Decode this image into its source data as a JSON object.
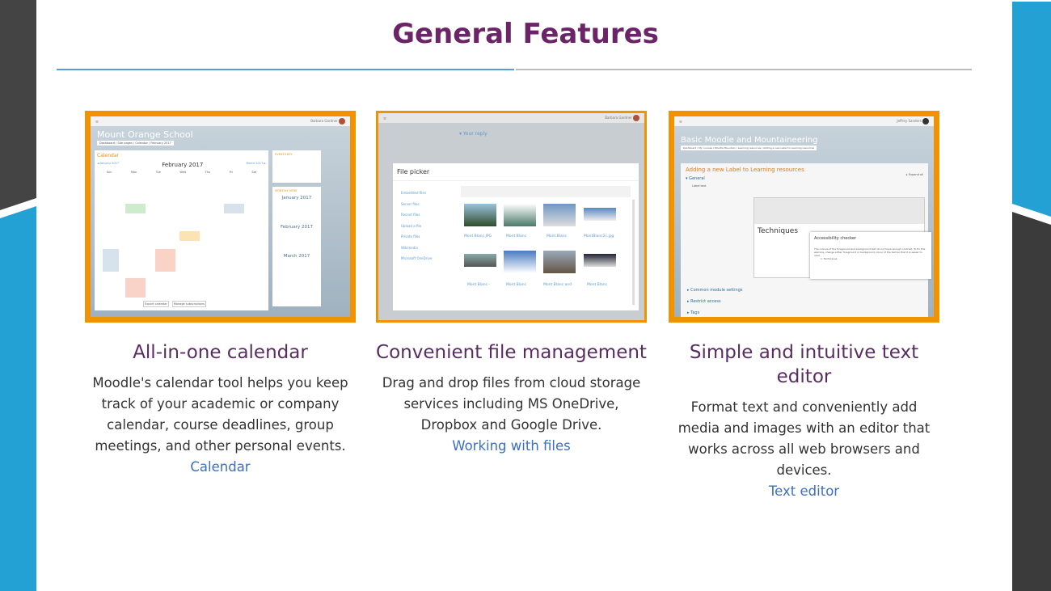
{
  "slide": {
    "title": "General Features",
    "colors": {
      "title": "#6b2468",
      "accent_blue": "#23a0d4",
      "dark": "#3f3f3f",
      "frame": "#f39200",
      "link": "#3d6fc0"
    }
  },
  "cards": [
    {
      "title": "All-in-one calendar",
      "description": "Moodle's calendar tool helps you keep track of your academic or company calendar, course deadlines, group meetings, and other personal events.",
      "link": "Calendar",
      "screenshot": {
        "site": "Mount Orange School",
        "breadcrumb": "Dashboard / Site pages / Calendar / February 2017",
        "heading": "Calendar",
        "month": "February 2017",
        "prev": "◄ January 2017",
        "next": "March 2017 ►",
        "new_event": "New event",
        "days": [
          "Sun",
          "Mon",
          "Tue",
          "Wed",
          "Thu",
          "Fri",
          "Sat"
        ],
        "block_key": "EVENTS KEY",
        "block_month": "MONTHLY VIEW",
        "mini": [
          "January 2017",
          "February 2017",
          "March 2017"
        ],
        "buttons": [
          "Export calendar",
          "Manage subscriptions"
        ],
        "user": "Barbara Gardner"
      }
    },
    {
      "title": "Convenient file management",
      "description": "Drag and drop files from cloud storage services including MS OneDrive, Dropbox and Google Drive.",
      "link": "Working with files",
      "screenshot": {
        "dialog_title": "File picker",
        "reply": "▾ Your reply",
        "sources": [
          "Embedded files",
          "Server files",
          "Recent files",
          "Upload a file",
          "Private files",
          "Wikimedia",
          "Microsoft OneDrive"
        ],
        "files": [
          "Mont Blanc.JPG",
          "Mont Blanc",
          "Mont Blanc",
          "MontBlanc2c.jpg",
          "Mont Blanc -",
          "Mont Blanc",
          "Mont Blanc and",
          "Mont Blanc"
        ],
        "user": "Barbara Gardner"
      }
    },
    {
      "title": "Simple and intuitive text editor",
      "description": "Format text and conveniently add media and images with an editor that works across all web browsers and devices.",
      "link": "Text editor",
      "screenshot": {
        "course": "Basic Moodle and Mountaineering",
        "breadcrumb": "Dashboard / My courses / Moodle Mountain / Learning resources / Adding a new Label to Learning resources",
        "heading": "Adding a new Label to Learning resources",
        "expand": "▸ Expand all",
        "general": "▾ General",
        "label_text": "Label text",
        "content": "Techniques",
        "checker_title": "Accessibility checker",
        "checker_text": "The colours of the foreground and background text do not have enough contrast. To fix this warning, change either foreground or background colour of the text so that it is easier to read.",
        "checker_item": "1. Techniques",
        "sections": [
          "▸ Common module settings",
          "▸ Restrict access",
          "▸ Tags"
        ],
        "user": "Jeffrey Sanders"
      }
    }
  ]
}
